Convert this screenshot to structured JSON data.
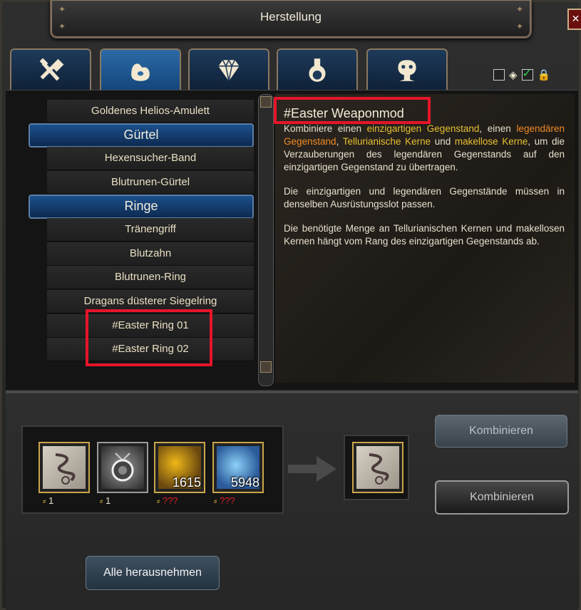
{
  "window": {
    "title": "Herstellung",
    "close_label": "✕"
  },
  "tabs": [
    {
      "name": "tools-tab"
    },
    {
      "name": "pouch-tab"
    },
    {
      "name": "gem-tab"
    },
    {
      "name": "potion-tab"
    },
    {
      "name": "mask-trophy-tab"
    }
  ],
  "filters": {
    "checkbox1_checked": false,
    "checkbox2_checked": true
  },
  "recipe_list": {
    "items": [
      {
        "label": "Goldenes Helios-Amulett",
        "type": "item"
      },
      {
        "label": "Gürtel",
        "type": "header"
      },
      {
        "label": "Hexensucher-Band",
        "type": "item"
      },
      {
        "label": "Blutrunen-Gürtel",
        "type": "item"
      },
      {
        "label": "Ringe",
        "type": "header"
      },
      {
        "label": "Tränengriff",
        "type": "item"
      },
      {
        "label": "Blutzahn",
        "type": "item"
      },
      {
        "label": "Blutrunen-Ring",
        "type": "item"
      },
      {
        "label": "Dragans düsterer Siegelring",
        "type": "item"
      },
      {
        "label": "#Easter Ring 01",
        "type": "item"
      },
      {
        "label": "#Easter Ring 02",
        "type": "item"
      }
    ]
  },
  "description": {
    "title": "#Easter Weaponmod",
    "p1_a": "Kombiniere einen ",
    "p1_b": "einzigartigen Gegenstand",
    "p1_c": ", einen ",
    "p1_d": "legendären Gegenstand",
    "p1_e": ", ",
    "p1_f": "Tellurianische Kerne",
    "p1_g": " und ",
    "p1_h": "makellose Kerne",
    "p1_i": ", um die Verzauberungen des legendären Gegenstands auf den einzigartigen Gegenstand zu übertragen.",
    "p2": "Die einzigartigen und legendären Gegenstände müssen in denselben Ausrüstungsslot passen.",
    "p3": "Die benötigte Menge an Tellurianischen Kernen und makellosen Kernen hängt vom Rang des einzigartigen Gegenstands ab."
  },
  "ingredients": [
    {
      "count": "",
      "req": "1",
      "type": "whip"
    },
    {
      "count": "",
      "req": "1",
      "type": "amulet"
    },
    {
      "count": "1615",
      "req": "???",
      "type": "gold-core"
    },
    {
      "count": "5948",
      "req": "???",
      "type": "blue-core"
    }
  ],
  "buttons": {
    "combine1": "Kombinieren",
    "combine2": "Kombinieren",
    "take_all": "Alle herausnehmen"
  }
}
